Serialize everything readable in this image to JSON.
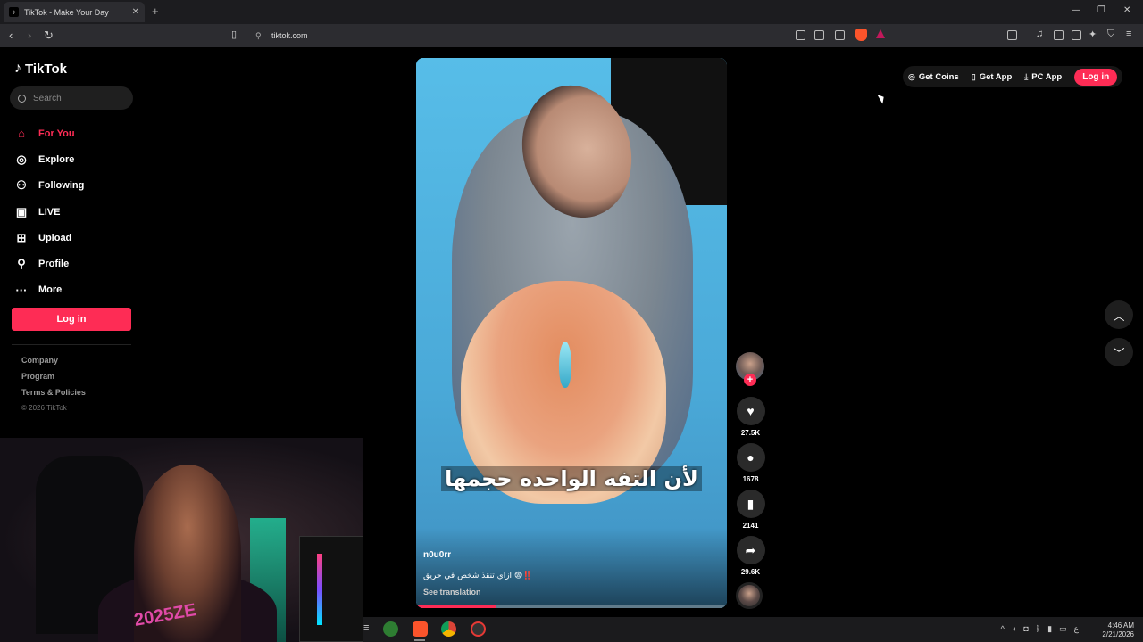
{
  "browser": {
    "tab_title": "TikTok - Make Your Day",
    "tab_close": "✕",
    "new_tab": "+",
    "url": "tiktok.com",
    "window_controls": [
      "—",
      "❐",
      "✕"
    ]
  },
  "sidebar": {
    "logo": "TikTok",
    "search_placeholder": "Search",
    "nav": [
      {
        "label": "For You",
        "icon": "home-icon",
        "active": true
      },
      {
        "label": "Explore",
        "icon": "compass-icon",
        "active": false
      },
      {
        "label": "Following",
        "icon": "person-plus-icon",
        "active": false
      },
      {
        "label": "LIVE",
        "icon": "live-icon",
        "active": false
      },
      {
        "label": "Upload",
        "icon": "plus-square-icon",
        "active": false
      },
      {
        "label": "Profile",
        "icon": "person-icon",
        "active": false
      },
      {
        "label": "More",
        "icon": "ellipsis-icon",
        "active": false
      }
    ],
    "login_label": "Log in",
    "footer": [
      "Company",
      "Program",
      "Terms & Policies"
    ],
    "copyright": "© 2026 TikTok"
  },
  "webcam": {
    "shirt_text": "2025ZE"
  },
  "video": {
    "caption": "لأن التفه الواحده حجمها",
    "username": "n0u0rr",
    "description": "‼️😨 ازاي تنقذ شخص في حريق",
    "see_translation": "See translation",
    "progress": 0.26
  },
  "actions": {
    "likes": "27.5K",
    "comments": "1678",
    "saves": "2141",
    "shares": "29.6K"
  },
  "topbar": {
    "get_coins": "Get Coins",
    "get_app": "Get App",
    "pc_app": "PC App",
    "login": "Log in"
  },
  "taskbar": {
    "time": "4:46 AM",
    "date": "2/21/2026",
    "lang": "ع"
  },
  "colors": {
    "accent": "#fe2c55",
    "background": "#000000"
  }
}
